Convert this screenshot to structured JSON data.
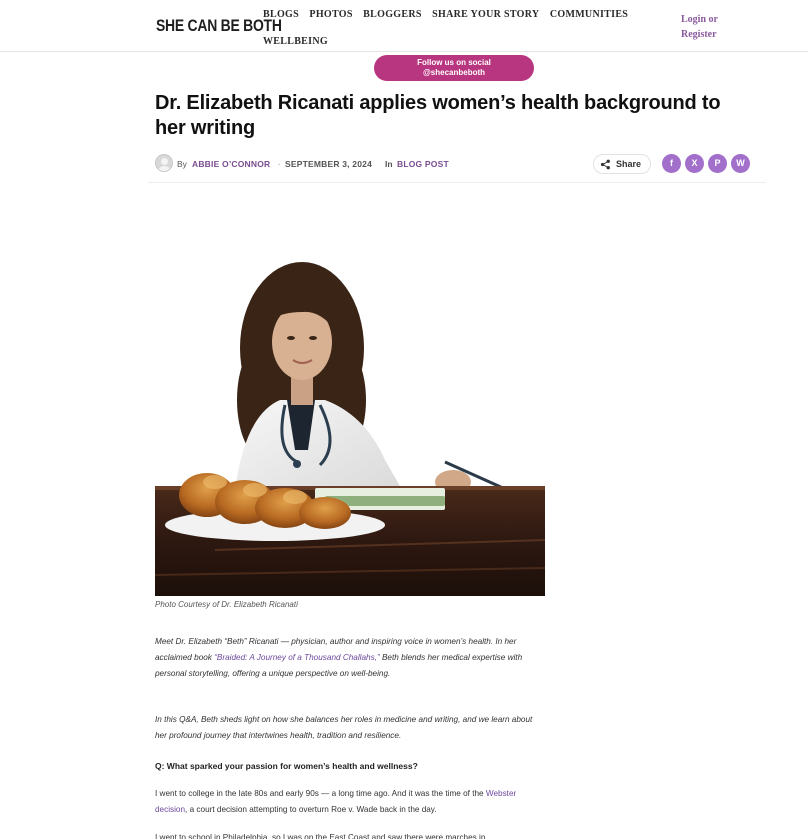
{
  "site": {
    "logo": "SHE CAN BE BOTH",
    "nav": [
      "BLOGS",
      "PHOTOS",
      "BLOGGERS",
      "SHARE YOUR STORY",
      "COMMUNITIES",
      "WELLBEING"
    ],
    "login_line1": "Login or",
    "login_line2": "Register"
  },
  "follow": {
    "line1": "Follow us on social",
    "line2": "@shecanbeboth",
    "color": "#b8357f"
  },
  "article": {
    "title": "Dr. Elizabeth Ricanati applies women’s health background to her writing",
    "by": "By",
    "author": "ABBIE O’CONNOR",
    "date": "SEPTEMBER 3, 2024",
    "in": "In",
    "category": "BLOG POST",
    "share_label": "Share",
    "social_icons": [
      "facebook-icon",
      "x-icon",
      "pinterest-icon",
      "whatsapp-icon"
    ],
    "social_glyphs": [
      "f",
      "X",
      "P",
      "W"
    ],
    "photo_caption": "Photo Courtesy of Dr. Elizabeth Ricanati",
    "p1_a": "Meet Dr. Elizabeth “Beth” Ricanati — physician, author and inspiring voice in women’s health. In her acclaimed book ",
    "p1_link": "“Braided: A Journey of a Thousand Challahs,”",
    "p1_b": " Beth blends her medical expertise with personal storytelling, offering a unique perspective on well-being.",
    "p2": "In this Q&A, Beth sheds light on how she balances her roles in medicine and writing, and we learn about her profound journey that intertwines health, tradition and resilience.",
    "q1": "Q: What sparked your passion for women’s health and wellness?",
    "p4_a": "I went to college in the late 80s and early 90s — a long time ago. And it was the time of the ",
    "p4_link": "Webster decision",
    "p4_b": ", a court decision attempting to overturn Roe v. Wade back in the day.",
    "p5": "I went to school in Philadelphia, so I was on the East Coast and saw there were marches in"
  },
  "colors": {
    "accent_purple": "#a26fcb",
    "link_purple": "#6d4a9e"
  }
}
